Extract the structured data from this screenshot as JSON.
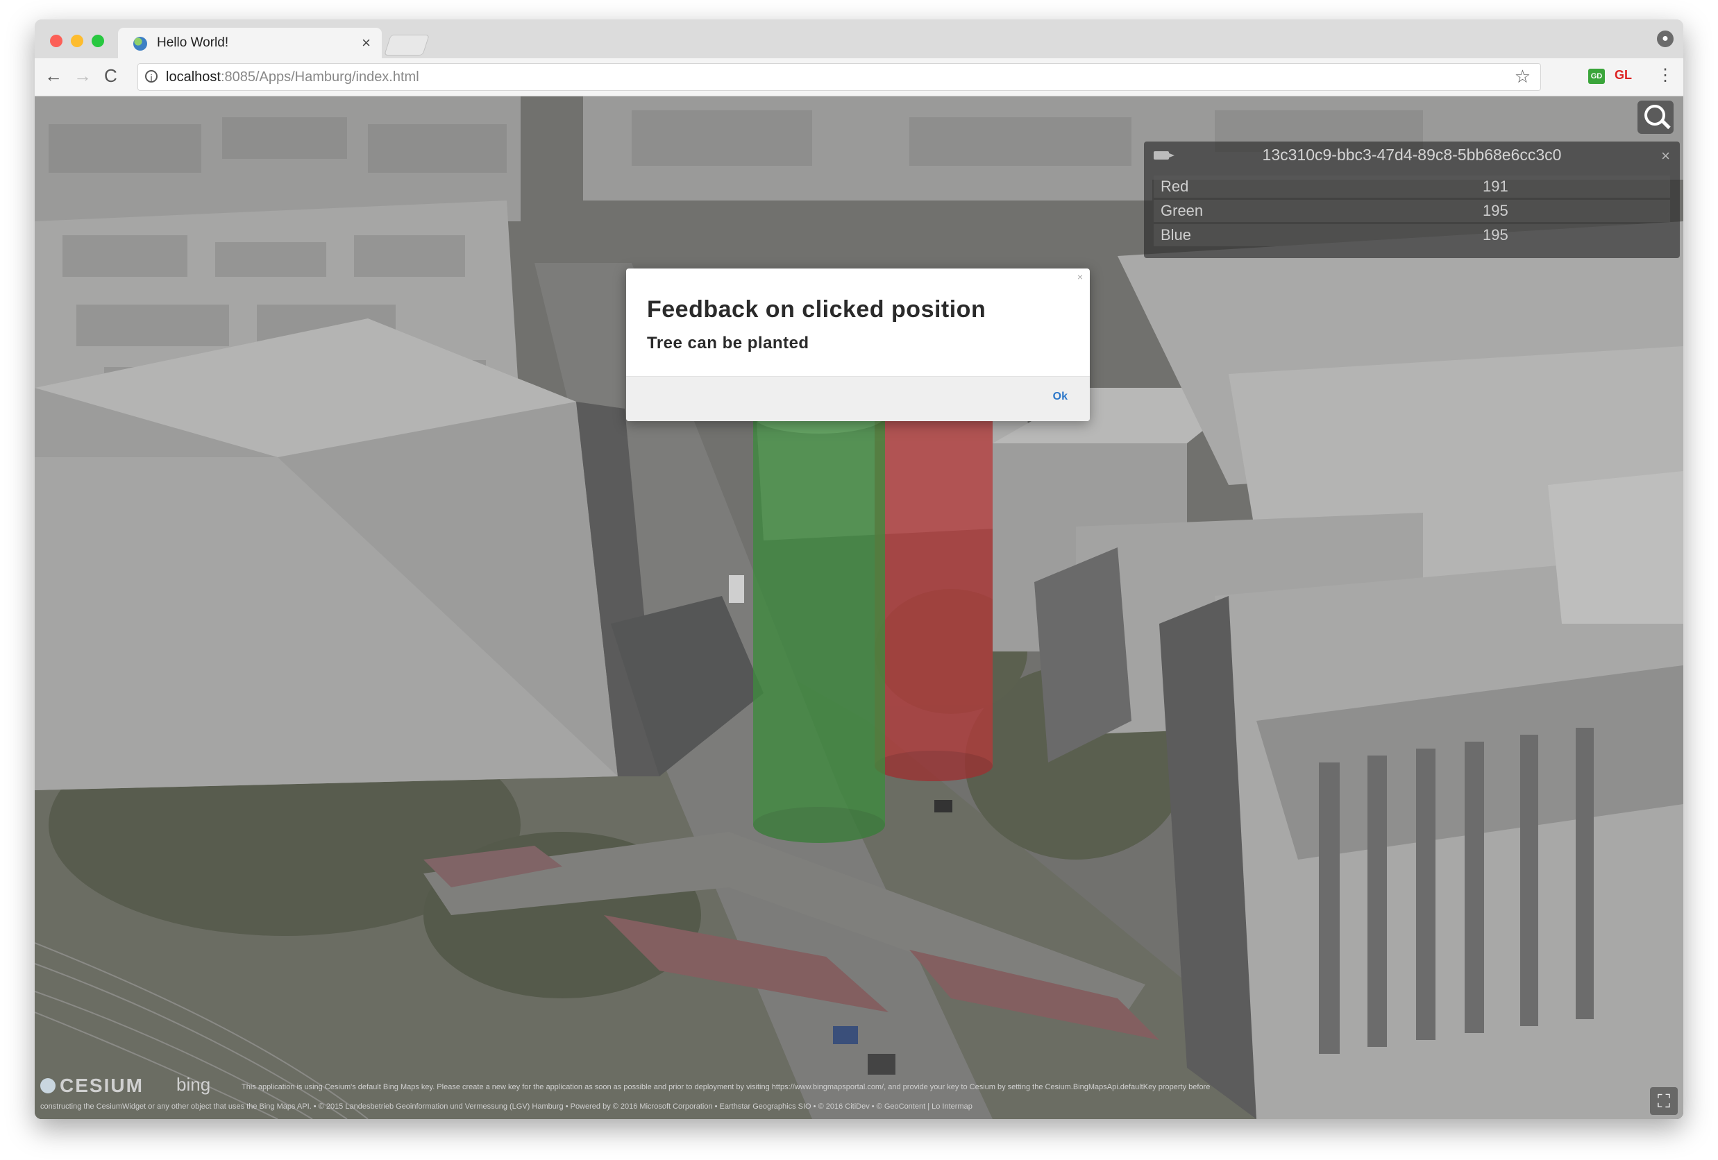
{
  "browser": {
    "tab_title": "Hello World!",
    "tab_close": "×",
    "url_host": "localhost",
    "url_rest": ":8085/Apps/Hamburg/index.html",
    "nav_back": "←",
    "nav_forward": "→",
    "nav_reload": "C",
    "info_icon": "i",
    "star_icon": "☆",
    "menu_icon": "⋮",
    "extension_1": "GD",
    "extension_2": "GL"
  },
  "infobox": {
    "title": "13c310c9-bbc3-47d4-89c8-5bb68e6cc3c0",
    "close": "×",
    "rows": [
      {
        "label": "Red",
        "value": "191"
      },
      {
        "label": "Green",
        "value": "195"
      },
      {
        "label": "Blue",
        "value": "195"
      }
    ]
  },
  "dialog": {
    "close": "×",
    "title": "Feedback on clicked position",
    "message": "Tree can be planted",
    "ok_label": "Ok"
  },
  "credits": {
    "cesium": "CESIUM",
    "bing": "bing",
    "line1": "This application is using Cesium's default Bing Maps key. Please create a new key for the application as soon as possible and prior to deployment by visiting https://www.bingmapsportal.com/, and provide your key to Cesium by setting the Cesium.BingMapsApi.defaultKey property before",
    "line2": "constructing the CesiumWidget or any other object that uses the Bing Maps API. • © 2015 Landesbetrieb Geoinformation und Vermessung (LGV) Hamburg • Powered by © 2016 Microsoft Corporation • Earthstar Geographics SIO • © 2016 CitiDev • © GeoContent | Lo Intermap",
    "fullscreen_icon": "⛶"
  },
  "colors": {
    "dialog_ok": "#2c77c9",
    "cylinder_red": "#b23a3a",
    "cylinder_green": "#3f8a3f"
  }
}
